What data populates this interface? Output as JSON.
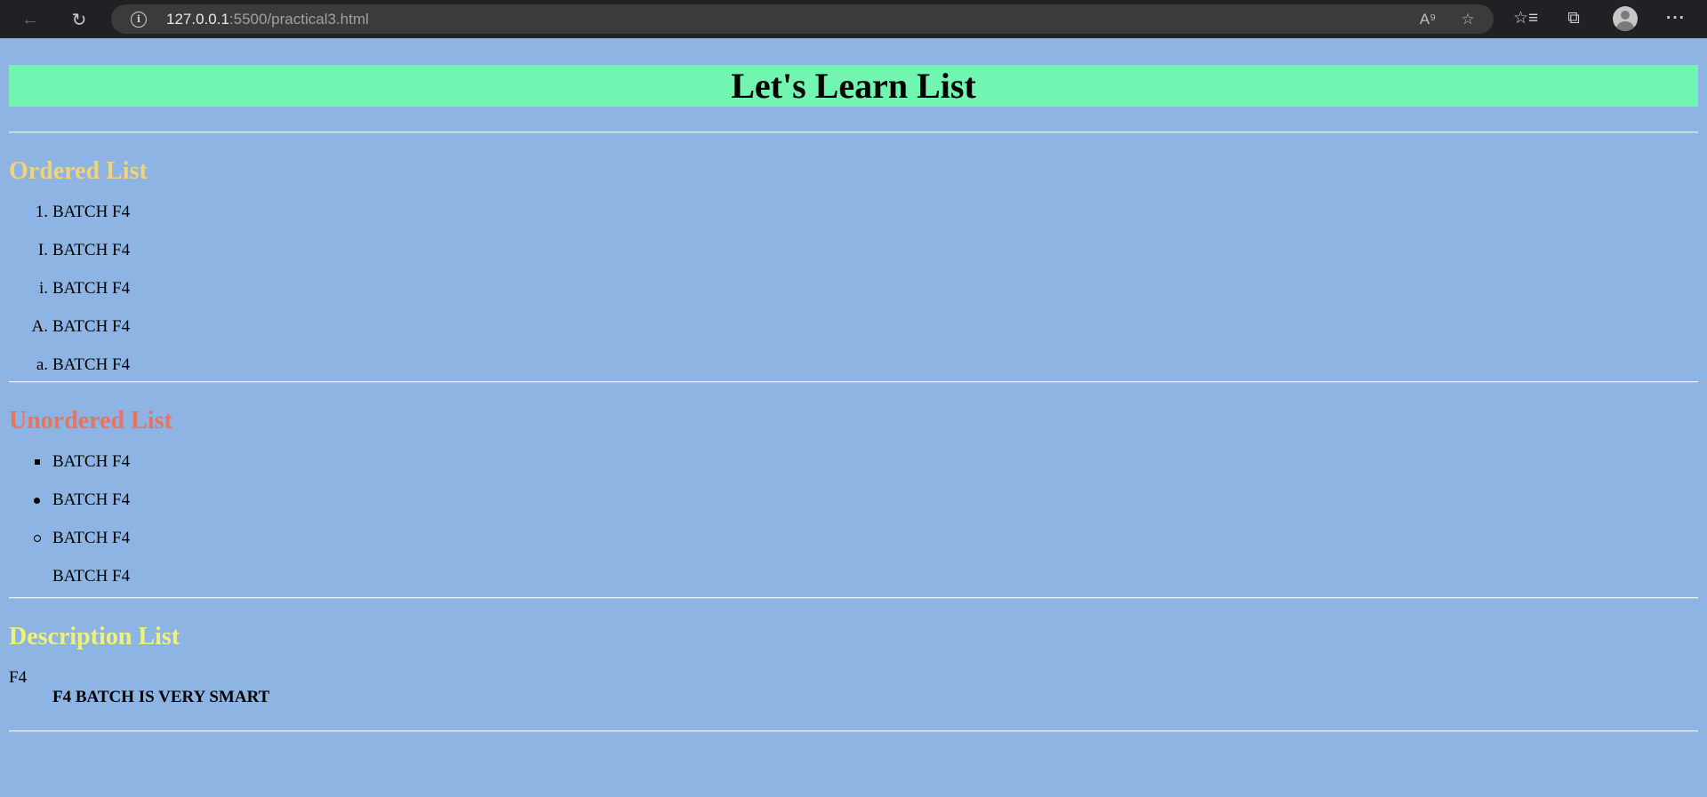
{
  "browser": {
    "url_host": "127.0.0.1",
    "url_rest": ":5500/practical3.html"
  },
  "page": {
    "title": "Let's Learn List",
    "ordered": {
      "heading": "Ordered List",
      "heading_color": "#f4d27a",
      "items": [
        {
          "marker": "1.",
          "text": "BATCH F4"
        },
        {
          "marker": "I.",
          "text": "BATCH F4"
        },
        {
          "marker": "i.",
          "text": "BATCH F4"
        },
        {
          "marker": "A.",
          "text": "BATCH F4"
        },
        {
          "marker": "a.",
          "text": "BATCH F4"
        }
      ]
    },
    "unordered": {
      "heading": "Unordered List",
      "heading_color": "#e8735f",
      "items": [
        {
          "marker": "square",
          "text": "BATCH F4"
        },
        {
          "marker": "disc",
          "text": "BATCH F4"
        },
        {
          "marker": "circle",
          "text": "BATCH F4"
        },
        {
          "marker": "none",
          "text": "BATCH F4"
        }
      ]
    },
    "description": {
      "heading": "Description List",
      "heading_color": "#eef27a",
      "term": "F4",
      "definition": "F4 BATCH IS VERY SMART"
    },
    "background": "#8db4e3",
    "title_background": "#72f5b0"
  }
}
